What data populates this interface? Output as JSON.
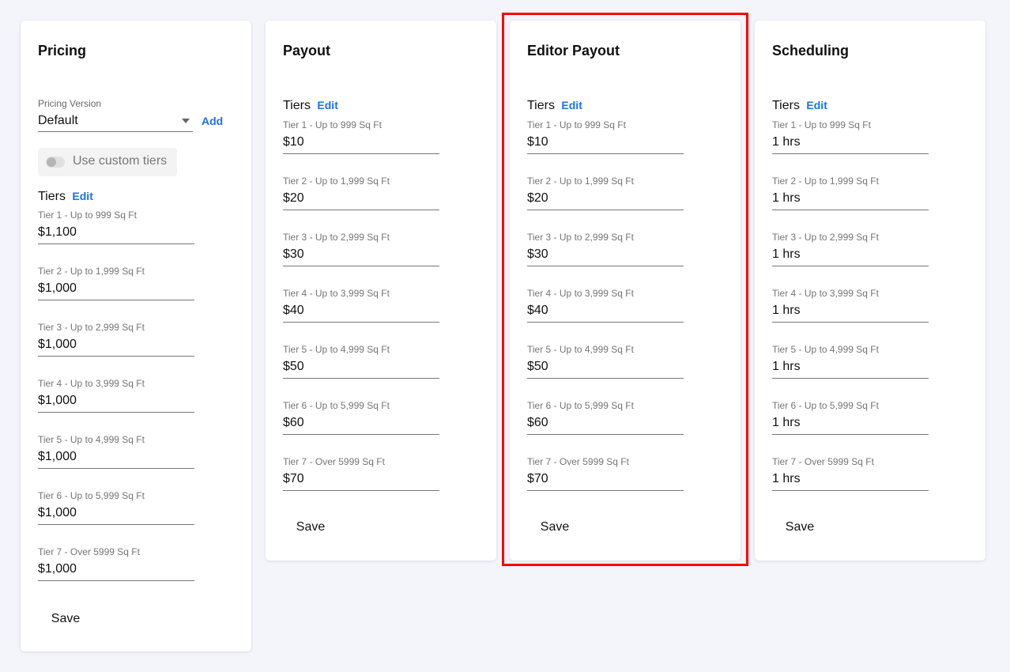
{
  "pricing": {
    "title": "Pricing",
    "version_label": "Pricing Version",
    "version_value": "Default",
    "add_label": "Add",
    "toggle_label": "Use custom tiers",
    "tiers_label": "Tiers",
    "edit_label": "Edit",
    "save_label": "Save",
    "tiers": [
      {
        "label": "Tier 1 - Up to 999 Sq Ft",
        "value": "$1,100"
      },
      {
        "label": "Tier 2 - Up to 1,999 Sq Ft",
        "value": "$1,000"
      },
      {
        "label": "Tier 3 - Up to 2,999 Sq Ft",
        "value": "$1,000"
      },
      {
        "label": "Tier 4 - Up to 3,999 Sq Ft",
        "value": "$1,000"
      },
      {
        "label": "Tier 5 - Up to 4,999 Sq Ft",
        "value": "$1,000"
      },
      {
        "label": "Tier 6 - Up to 5,999 Sq Ft",
        "value": "$1,000"
      },
      {
        "label": "Tier 7 - Over 5999 Sq Ft",
        "value": "$1,000"
      }
    ]
  },
  "payout": {
    "title": "Payout",
    "tiers_label": "Tiers",
    "edit_label": "Edit",
    "save_label": "Save",
    "tiers": [
      {
        "label": "Tier 1 - Up to 999 Sq Ft",
        "value": "$10"
      },
      {
        "label": "Tier 2 - Up to 1,999 Sq Ft",
        "value": "$20"
      },
      {
        "label": "Tier 3 - Up to 2,999 Sq Ft",
        "value": "$30"
      },
      {
        "label": "Tier 4 - Up to 3,999 Sq Ft",
        "value": "$40"
      },
      {
        "label": "Tier 5 - Up to 4,999 Sq Ft",
        "value": "$50"
      },
      {
        "label": "Tier 6 - Up to 5,999 Sq Ft",
        "value": "$60"
      },
      {
        "label": "Tier 7 - Over 5999 Sq Ft",
        "value": "$70"
      }
    ]
  },
  "editor_payout": {
    "title": "Editor Payout",
    "tiers_label": "Tiers",
    "edit_label": "Edit",
    "save_label": "Save",
    "tiers": [
      {
        "label": "Tier 1 - Up to 999 Sq Ft",
        "value": "$10"
      },
      {
        "label": "Tier 2 - Up to 1,999 Sq Ft",
        "value": "$20"
      },
      {
        "label": "Tier 3 - Up to 2,999 Sq Ft",
        "value": "$30"
      },
      {
        "label": "Tier 4 - Up to 3,999 Sq Ft",
        "value": "$40"
      },
      {
        "label": "Tier 5 - Up to 4,999 Sq Ft",
        "value": "$50"
      },
      {
        "label": "Tier 6 - Up to 5,999 Sq Ft",
        "value": "$60"
      },
      {
        "label": "Tier 7 - Over 5999 Sq Ft",
        "value": "$70"
      }
    ]
  },
  "scheduling": {
    "title": "Scheduling",
    "tiers_label": "Tiers",
    "edit_label": "Edit",
    "save_label": "Save",
    "tiers": [
      {
        "label": "Tier 1 - Up to 999 Sq Ft",
        "value": "1 hrs"
      },
      {
        "label": "Tier 2 - Up to 1,999 Sq Ft",
        "value": "1 hrs"
      },
      {
        "label": "Tier 3 - Up to 2,999 Sq Ft",
        "value": "1 hrs"
      },
      {
        "label": "Tier 4 - Up to 3,999 Sq Ft",
        "value": "1 hrs"
      },
      {
        "label": "Tier 5 - Up to 4,999 Sq Ft",
        "value": "1 hrs"
      },
      {
        "label": "Tier 6 - Up to 5,999 Sq Ft",
        "value": "1 hrs"
      },
      {
        "label": "Tier 7 - Over 5999 Sq Ft",
        "value": "1 hrs"
      }
    ]
  },
  "colors": {
    "accent": "#1a73e8",
    "highlight_border": "#ff0000",
    "background": "#f4f5fa"
  }
}
